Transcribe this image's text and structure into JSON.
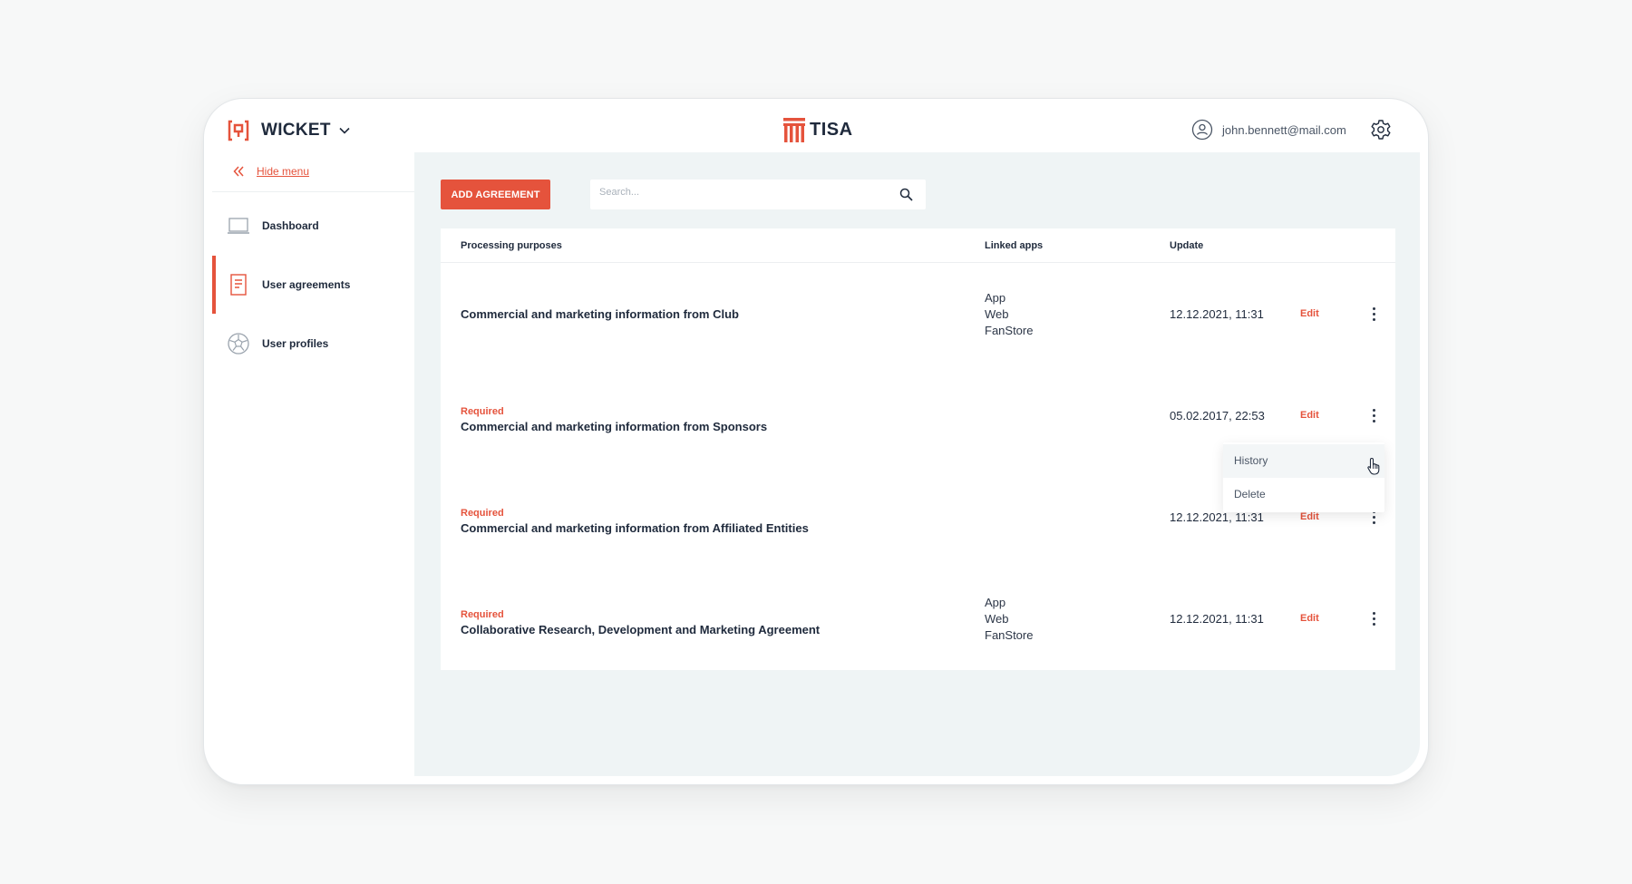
{
  "header": {
    "brand_name": "WICKET",
    "center_logo_text": "TISA",
    "user_email": "john.bennett@mail.com"
  },
  "sidebar": {
    "hide_menu_label": "Hide menu",
    "items": [
      {
        "label": "Dashboard",
        "icon": "laptop-icon",
        "active": false
      },
      {
        "label": "User agreements",
        "icon": "document-icon",
        "active": true
      },
      {
        "label": "User profiles",
        "icon": "soccer-ball-icon",
        "active": false
      }
    ]
  },
  "toolbar": {
    "add_label": "ADD AGREEMENT",
    "search_placeholder": "Search..."
  },
  "table": {
    "headers": [
      "Processing purposes",
      "Linked apps",
      "Update"
    ],
    "rows": [
      {
        "required": "",
        "purpose": "Commercial and marketing information from Club",
        "apps": [
          "App",
          "Web",
          "FanStore"
        ],
        "date": "12.12.2021, 11:31",
        "edit": "Edit"
      },
      {
        "required": "Required",
        "purpose": "Commercial and marketing information from Sponsors",
        "apps": [],
        "date": "05.02.2017, 22:53",
        "edit": "Edit"
      },
      {
        "required": "Required",
        "purpose": "Commercial and marketing information from Affiliated Entities",
        "apps": [],
        "date": "12.12.2021, 11:31",
        "edit": "Edit"
      },
      {
        "required": "Required",
        "purpose": "Collaborative Research, Development and Marketing Agreement",
        "apps": [
          "App",
          "Web",
          "FanStore"
        ],
        "date": "12.12.2021, 11:31",
        "edit": "Edit"
      }
    ]
  },
  "dropdown": {
    "items": [
      "History",
      "Delete"
    ]
  },
  "colors": {
    "accent": "#e5533c",
    "text": "#1f2a3c",
    "main_bg": "#eff4f5"
  }
}
